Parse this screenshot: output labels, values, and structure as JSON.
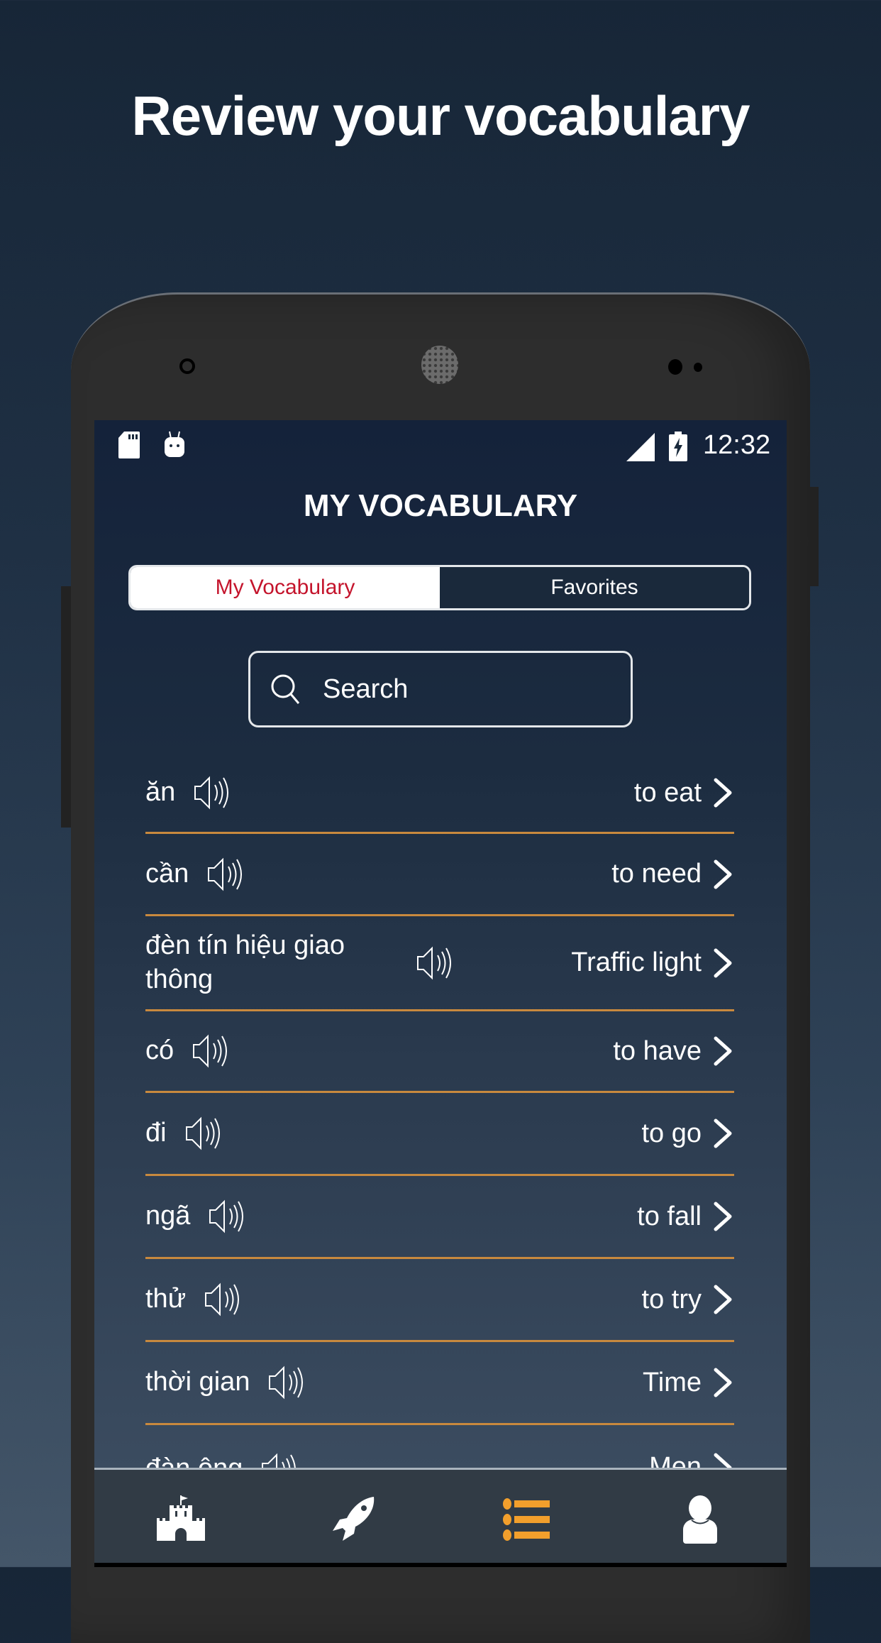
{
  "promo": {
    "title": "Review your vocabulary"
  },
  "statusbar": {
    "time": "12:32",
    "icons": [
      "sd-card-icon",
      "android-icon",
      "signal-icon",
      "battery-charging-icon"
    ]
  },
  "app": {
    "title": "MY VOCABULARY",
    "tabs": [
      {
        "label": "My Vocabulary",
        "active": true
      },
      {
        "label": "Favorites",
        "active": false
      }
    ],
    "search": {
      "placeholder": "Search",
      "value": ""
    },
    "colors": {
      "active_tab_text": "#c4142c",
      "divider": "#c8893e",
      "nav_active": "#f29f2c"
    }
  },
  "vocabulary": [
    {
      "word": "ăn",
      "translation": "to eat"
    },
    {
      "word": "cần",
      "translation": "to need"
    },
    {
      "word": "đèn tín hiệu giao thông",
      "translation": "Traffic light"
    },
    {
      "word": "có",
      "translation": "to have"
    },
    {
      "word": "đi",
      "translation": "to go"
    },
    {
      "word": "ngã",
      "translation": "to fall"
    },
    {
      "word": "thử",
      "translation": "to try"
    },
    {
      "word": "thời gian",
      "translation": "Time"
    },
    {
      "word": "đàn ông",
      "translation": "Men"
    }
  ],
  "bottom_nav": [
    {
      "icon": "castle-icon",
      "active": false
    },
    {
      "icon": "rocket-icon",
      "active": false
    },
    {
      "icon": "list-icon",
      "active": true
    },
    {
      "icon": "user-icon",
      "active": false
    }
  ]
}
